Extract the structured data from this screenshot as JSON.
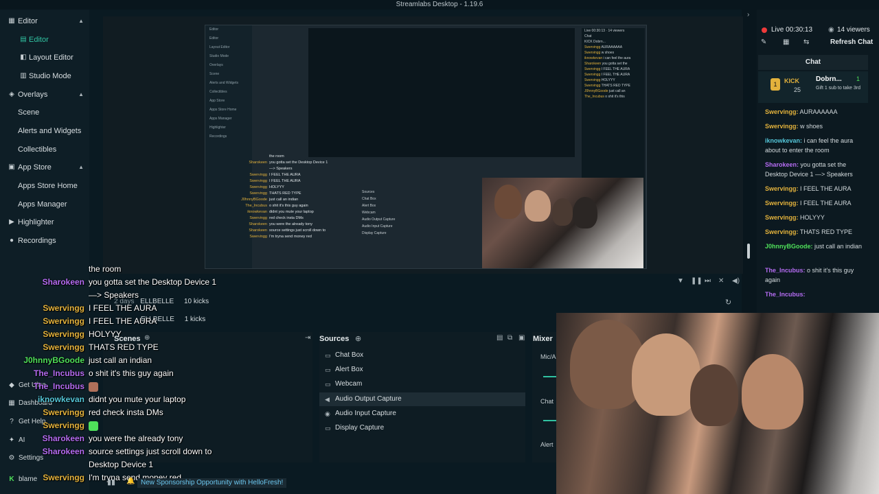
{
  "window": {
    "title": "Streamlabs Desktop - 1.19.6"
  },
  "sidebar": {
    "sections": [
      {
        "label": "Editor",
        "icon": "editor-icon",
        "items": [
          "Editor",
          "Layout Editor",
          "Studio Mode"
        ]
      },
      {
        "label": "Overlays",
        "icon": "overlays-icon",
        "items": [
          "Scene",
          "Alerts and Widgets",
          "Collectibles"
        ]
      },
      {
        "label": "App Store",
        "icon": "app-store-icon",
        "items": [
          "Apps Store Home",
          "Apps Manager"
        ]
      }
    ],
    "highlighter": "Highlighter",
    "recordings": "Recordings",
    "bottom": {
      "get_ultra": "Get Ultra",
      "dashboard": "Dashboard",
      "get_help": "Get Help",
      "ai": "AI",
      "settings": "Settings",
      "user": "blame"
    }
  },
  "events": [
    {
      "time": "2 days",
      "name": "ELLBELLE",
      "detail": "10 kicks"
    },
    {
      "time": "",
      "name": "ELLBELLE",
      "detail": "1 kicks"
    }
  ],
  "scenes": {
    "title": "Scenes"
  },
  "sources": {
    "title": "Sources",
    "items": [
      "Chat Box",
      "Alert Box",
      "Webcam",
      "Audio Output Capture",
      "Audio Input Capture",
      "Display Capture"
    ],
    "selected_index": 3
  },
  "mixer": {
    "title": "Mixer",
    "items": [
      "Mic/A",
      "Chat",
      "Alert"
    ]
  },
  "chat_overlay": [
    {
      "name": "",
      "msg": "the room",
      "color": "#ffffff"
    },
    {
      "name": "Sharokeen",
      "msg": "you gotta set the Desktop Device 1",
      "color": "#b56cf2"
    },
    {
      "name": "",
      "msg": "—> Speakers",
      "color": "#ffffff"
    },
    {
      "name": "Swervingg",
      "msg": "I FEEL THE AURA",
      "color": "#e3b23c"
    },
    {
      "name": "Swervingg",
      "msg": "I FEEL THE AURA",
      "color": "#e3b23c"
    },
    {
      "name": "Swervingg",
      "msg": "HOLYYY",
      "color": "#e3b23c"
    },
    {
      "name": "Swervingg",
      "msg": "THATS RED TYPE",
      "color": "#e3b23c"
    },
    {
      "name": "J0hnnyBGoode",
      "msg": "just call an indian",
      "color": "#4fe05a"
    },
    {
      "name": "The_Incubus",
      "msg": "o shit it's this guy again",
      "color": "#b56cf2"
    },
    {
      "name": "The_Incubus",
      "msg": "",
      "color": "#b56cf2"
    },
    {
      "name": "iknowkevan",
      "msg": "didnt you mute your laptop",
      "color": "#54c6d8"
    },
    {
      "name": "Swervingg",
      "msg": "red check insta DMs",
      "color": "#e3b23c"
    },
    {
      "name": "Swervingg",
      "msg": "",
      "color": "#e3b23c"
    },
    {
      "name": "Sharokeen",
      "msg": "you were the already tony",
      "color": "#b56cf2"
    },
    {
      "name": "Sharokeen",
      "msg": "source settings just scroll down to",
      "color": "#b56cf2"
    },
    {
      "name": "",
      "msg": "Desktop Device 1",
      "color": "#ffffff"
    },
    {
      "name": "Swervingg",
      "msg": "I'm tryna send money red",
      "color": "#e3b23c"
    }
  ],
  "sponsor": "New Sponsorship Opportunity with HelloFresh!",
  "right_chat": {
    "status": "Live 00:30:13",
    "viewers": "14 viewers",
    "refresh": "Refresh Chat",
    "title": "Chat",
    "kick": {
      "brand": "KICK",
      "count": "25",
      "user": "Dobrn...",
      "badge": "1",
      "note": "Gift 1 sub to take 3rd"
    },
    "messages": [
      {
        "name": "Swervingg",
        "msg": "AURAAAAAA",
        "color": "#e3b23c"
      },
      {
        "name": "Swervingg",
        "msg": "w shoes",
        "color": "#e3b23c"
      },
      {
        "name": "iknowkevan",
        "msg": "i can feel the aura about to enter the room",
        "color": "#54c6d8"
      },
      {
        "name": "Sharokeen",
        "msg": "you gotta set the Desktop Device 1 —> Speakers",
        "color": "#b56cf2"
      },
      {
        "name": "Swervingg",
        "msg": "I FEEL THE AURA",
        "color": "#e3b23c"
      },
      {
        "name": "Swervingg",
        "msg": "I FEEL THE AURA",
        "color": "#e3b23c"
      },
      {
        "name": "Swervingg",
        "msg": "HOLYYY",
        "color": "#e3b23c"
      },
      {
        "name": "Swervingg",
        "msg": "THATS RED TYPE",
        "color": "#e3b23c"
      },
      {
        "name": "J0hnnyBGoode",
        "msg": "just call an indian",
        "color": "#4fe05a"
      },
      {
        "name": "The_Incubus",
        "msg": "o shit it's this guy again",
        "color": "#b56cf2"
      },
      {
        "name": "The_Incubus",
        "msg": "",
        "color": "#b56cf2"
      }
    ]
  },
  "colors": {
    "accent": "#31c3a2",
    "bg": "#09161d",
    "live": "#ee3a3a"
  }
}
